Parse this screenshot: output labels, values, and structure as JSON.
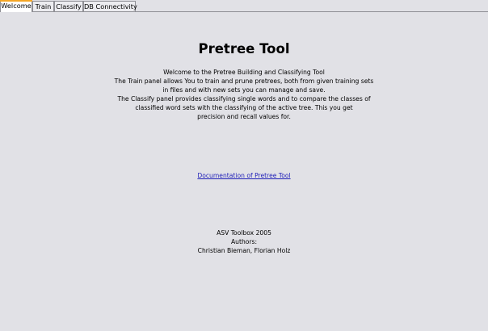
{
  "tabs": [
    {
      "label": "Welcome",
      "active": true
    },
    {
      "label": "Train",
      "active": false
    },
    {
      "label": "Classify",
      "active": false
    },
    {
      "label": "DB Connectivity",
      "active": false
    }
  ],
  "welcome": {
    "title": "Pretree Tool",
    "lines": [
      "Welcome to the Pretree Building and Classifying Tool",
      "The Train panel allows You to train and prune pretrees, both from given training sets",
      "in files and with new sets you can manage and save.",
      "The Classify panel provides classifying single words and to compare the classes of",
      "classified word sets with the classifying of the active tree. This you get",
      "precision and recall values for."
    ],
    "doc_link": "Documentation of Pretree Tool",
    "credits": [
      "ASV Toolbox 2005",
      "Authors:",
      "Christian Bieman, Florian Holz"
    ]
  },
  "colors": {
    "background": "#e1e1e6",
    "active_tab_accent": "#f5a623",
    "link": "#1f1fb8"
  }
}
